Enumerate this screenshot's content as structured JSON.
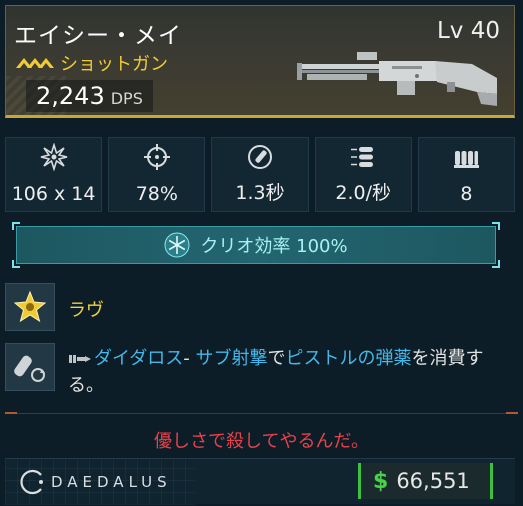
{
  "weapon": {
    "name": "エイシー・メイ",
    "level": "Lv 40",
    "type": "ショットガン",
    "dps_value": "2,243",
    "dps_label": "DPS",
    "rarity_color": "#f1cb35",
    "manufacturer_icon": "chevron-rank-icon"
  },
  "stats": [
    {
      "icon": "damage-burst-icon",
      "value": "106 x 14"
    },
    {
      "icon": "accuracy-crosshair-icon",
      "value": "78%"
    },
    {
      "icon": "reload-time-icon",
      "value": "1.3秒"
    },
    {
      "icon": "fire-rate-icon",
      "value": "2.0/秒"
    },
    {
      "icon": "magazine-icon",
      "value": "8"
    }
  ],
  "element": {
    "icon": "snowflake-icon",
    "label": "クリオ効率 100%",
    "color": "#a8f0f2"
  },
  "perks": {
    "perk1": {
      "icon": "star-badge-icon",
      "name": "ラヴ"
    },
    "perk2": {
      "icon": "ammo-cycle-icon",
      "parts": [
        {
          "text": "ダイダロス",
          "highlight": true
        },
        {
          "text": "- ",
          "highlight": false
        },
        {
          "text": "サブ射撃",
          "highlight": true
        },
        {
          "text": "で",
          "highlight": false
        },
        {
          "text": "ピストルの弾薬",
          "highlight": true
        },
        {
          "text": "を消費する。",
          "highlight": false
        }
      ]
    }
  },
  "flavor_text": "優しさで殺してやるんだ。",
  "footer": {
    "brand": "DAEDALUS",
    "currency_icon": "$",
    "price": "66,551"
  }
}
